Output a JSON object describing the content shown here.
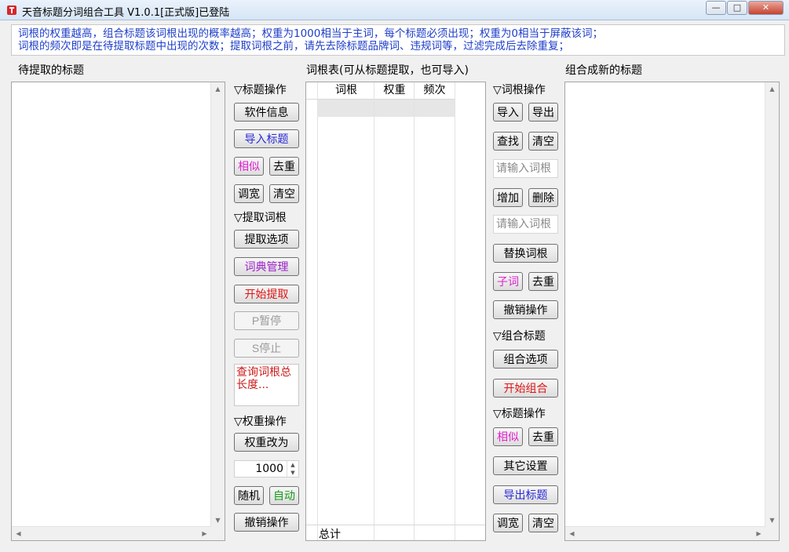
{
  "window": {
    "title": "天音标题分词组合工具 V1.0.1[正式版]已登陆",
    "minimize": "—",
    "maximize": "□",
    "close": "✕"
  },
  "info": {
    "line1": "词根的权重越高，组合标题该词根出现的概率越高；权重为1000相当于主词，每个标题必须出现；权重为0相当于屏蔽该词；",
    "line2": "词根的频次即是在待提取标题中出现的次数；提取词根之前，请先去除标题品牌词、违规词等，过滤完成后去除重复；"
  },
  "labels": {
    "left_title": "待提取的标题",
    "middle_title": "词根表(可从标题提取，也可导入)",
    "right_title": "组合成新的标题"
  },
  "title_ops": {
    "section": "▽标题操作",
    "software_info": "软件信息",
    "import_titles": "导入标题",
    "similar": "相似",
    "dedupe": "去重",
    "width": "调宽",
    "clear": "清空"
  },
  "extract": {
    "section": "▽提取词根",
    "options": "提取选项",
    "dictionary": "词典管理",
    "start": "开始提取",
    "pause": "P暂停",
    "stop": "S停止",
    "status": "查询词根总长度..."
  },
  "weight_ops": {
    "section": "▽权重操作",
    "change_to": "权重改为",
    "value": "1000",
    "random": "随机",
    "auto": "自动",
    "undo": "撤销操作"
  },
  "grid": {
    "columns": [
      "词根",
      "权重",
      "频次"
    ],
    "footer": "总计"
  },
  "root_ops": {
    "section": "▽词根操作",
    "import": "导入",
    "export": "导出",
    "find": "查找",
    "clear": "清空",
    "input1_placeholder": "请输入词根",
    "add": "增加",
    "delete": "删除",
    "input2_placeholder": "请输入词根",
    "replace": "替换词根",
    "subword": "子词",
    "dedupe": "去重",
    "undo": "撤销操作"
  },
  "combine": {
    "section": "▽组合标题",
    "options": "组合选项",
    "start": "开始组合"
  },
  "title_ops2": {
    "section": "▽标题操作",
    "similar": "相似",
    "dedupe": "去重",
    "other_settings": "其它设置",
    "export_titles": "导出标题",
    "width": "调宽",
    "clear": "清空"
  },
  "colors": {
    "info_text": "#1e3ec9",
    "blue_button": "#2a2ad8",
    "pink_button": "#e021d0",
    "red_button": "#e01414",
    "green_button": "#169c16"
  }
}
